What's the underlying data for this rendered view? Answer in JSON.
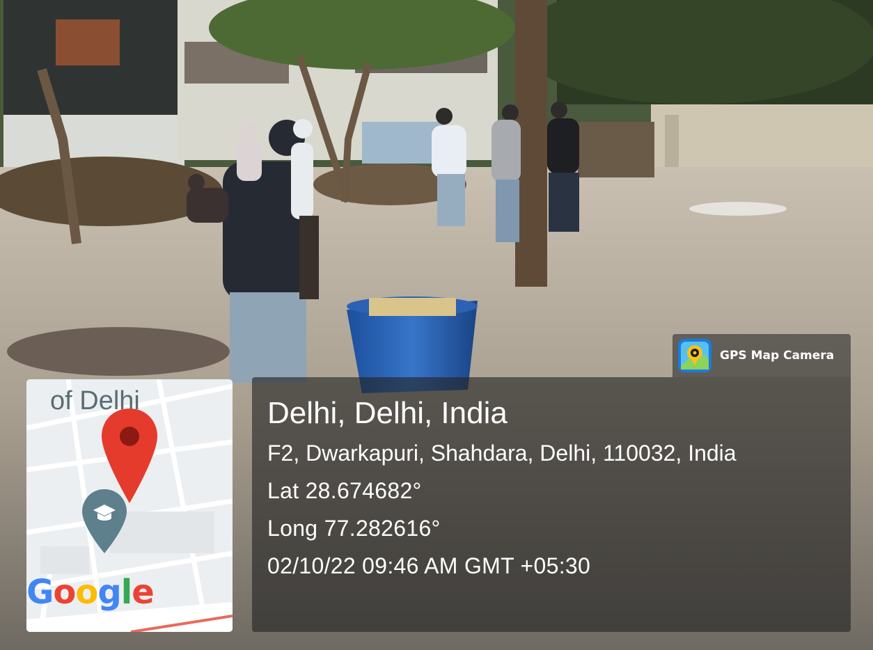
{
  "photo": {
    "subject": "Volunteers clearing litter and debris from an open ground with a blue bin and trees"
  },
  "gps_badge": {
    "app_name": "GPS Map Camera",
    "icon": "gps-map-camera-icon"
  },
  "location": {
    "city_line": "Delhi, Delhi, India",
    "address": "F2, Dwarkapuri, Shahdara, Delhi, 110032, India",
    "latitude": "Lat 28.674682°",
    "longitude": "Long 77.282616°",
    "datetime": "02/10/22 09:46 AM GMT +05:30"
  },
  "map": {
    "area_label": "of Delhi",
    "pin_icon": "location-pin-icon",
    "poi_icon": "graduation-cap-poi-icon",
    "provider_logo": "Google",
    "colors": {
      "pin": "#E53B2C",
      "poi": "#5E7F8C",
      "route": "#E86A5C"
    }
  }
}
